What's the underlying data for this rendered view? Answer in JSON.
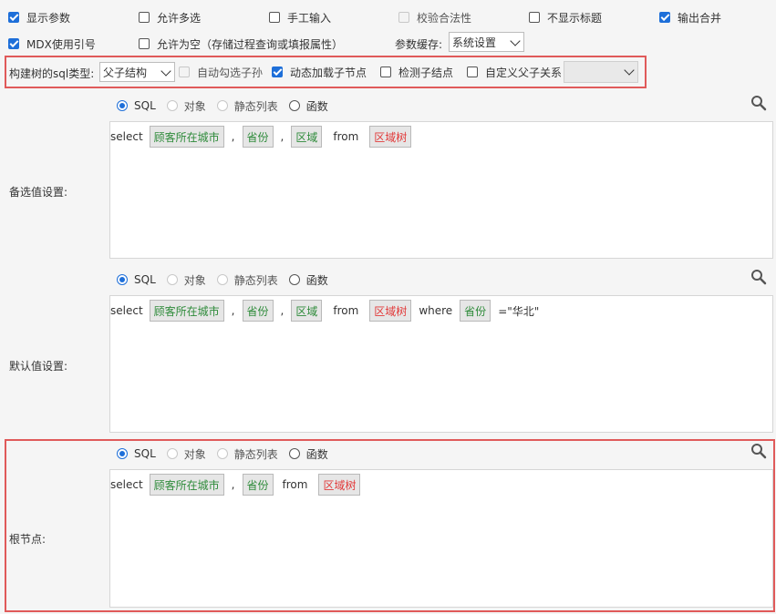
{
  "top_options": {
    "show_params": {
      "label": "显示参数",
      "checked": true
    },
    "allow_multi": {
      "label": "允许多选",
      "checked": false
    },
    "manual_input": {
      "label": "手工输入",
      "checked": false
    },
    "validate": {
      "label": "校验合法性",
      "checked": false,
      "disabled": true
    },
    "hide_title": {
      "label": "不显示标题",
      "checked": false
    },
    "output_merge": {
      "label": "输出合并",
      "checked": true
    },
    "mdx_ref": {
      "label": "MDX使用引号",
      "checked": true
    },
    "allow_empty": {
      "label": "允许为空（存储过程查询或填报属性）",
      "checked": false
    },
    "param_cache_label": "参数缓存:",
    "param_cache_value": "系统设置"
  },
  "tree_row": {
    "type_label": "构建树的sql类型:",
    "type_value": "父子结构",
    "auto_check_children": {
      "label": "自动勾选子孙",
      "checked": false,
      "disabled": true
    },
    "dynamic_load": {
      "label": "动态加载子节点",
      "checked": true
    },
    "detect_children": {
      "label": "检测子结点",
      "checked": false
    },
    "custom_relation": {
      "label": "自定义父子关系",
      "checked": false
    },
    "custom_relation_value": ""
  },
  "radio_labels": {
    "sql": "SQL",
    "object": "对象",
    "static": "静态列表",
    "function": "函数"
  },
  "sections": {
    "candidate": {
      "label": "备选值设置:",
      "kw_select": "select",
      "tok1": "顾客所在城市",
      "comma1": ",",
      "tok2": "省份",
      "comma2": ",",
      "tok3": "区域",
      "kw_from": "from",
      "tok4": "区域树"
    },
    "default": {
      "label": "默认值设置:",
      "kw_select": "select",
      "tok1": "顾客所在城市",
      "comma1": ",",
      "tok2": "省份",
      "comma2": ",",
      "tok3": "区域",
      "kw_from": "from",
      "tok4": "区域树",
      "kw_where": "where",
      "tok5": "省份",
      "cond": "=\"华北\""
    },
    "root": {
      "label": "根节点:",
      "kw_select": "select",
      "tok1": "顾客所在城市",
      "comma1": ",",
      "tok2": "省份",
      "kw_from": "from",
      "tok3": "区域树"
    }
  },
  "colors": {
    "accent": "#1e6fd9",
    "highlight_border": "#e05a5a",
    "field_green": "#2e8b3a",
    "table_red": "#e23b3b"
  }
}
